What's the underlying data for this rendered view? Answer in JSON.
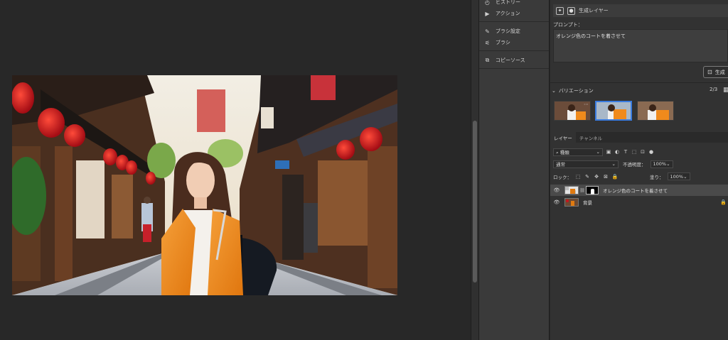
{
  "history_panel": {
    "items": [
      {
        "label": "ヒストリー",
        "icon": "history-icon"
      },
      {
        "label": "アクション",
        "icon": "play-icon"
      },
      {
        "label": "ブラシ設定",
        "icon": "brush-settings-icon"
      },
      {
        "label": "ブラシ",
        "icon": "brush-icon"
      },
      {
        "label": "コピーソース",
        "icon": "clone-source-icon"
      }
    ]
  },
  "properties": {
    "layer_type": "生成レイヤー",
    "prompt_label": "プロンプト：",
    "prompt_text": "オレンジ色のコートを着させて",
    "generate_button": "生成",
    "variations_label": "バリエーション",
    "variations_count": "2/3",
    "selected_variation": 2
  },
  "layers_panel": {
    "tabs": [
      "レイヤー",
      "チャンネル"
    ],
    "active_tab": "レイヤー",
    "filter_kind": "種類",
    "blend_mode": "通常",
    "opacity_label": "不透明度：",
    "opacity_value": "100%",
    "lock_label": "ロック：",
    "fill_label": "塗り：",
    "fill_value": "100%",
    "layers": [
      {
        "name": "オレンジ色のコートを着させて",
        "active": true,
        "has_mask": true
      },
      {
        "name": "背景",
        "active": false,
        "locked": true
      }
    ]
  },
  "colors": {
    "accent_selection": "#3a7ce0",
    "coat_orange": "#f08a1c",
    "lantern_red": "#c8141e"
  }
}
